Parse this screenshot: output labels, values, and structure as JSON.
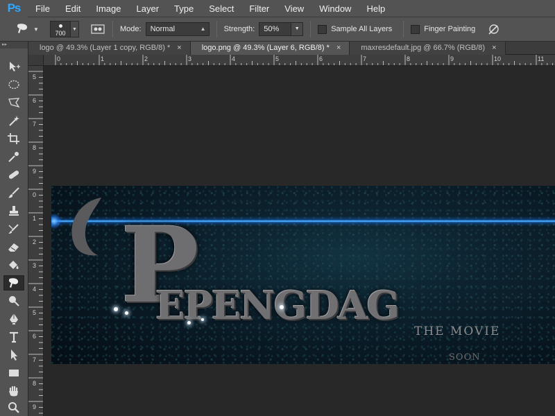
{
  "app": {
    "logo": "Ps",
    "menu": [
      "File",
      "Edit",
      "Image",
      "Layer",
      "Type",
      "Select",
      "Filter",
      "View",
      "Window",
      "Help"
    ]
  },
  "options": {
    "brush_size": "700",
    "mode_label": "Mode:",
    "mode_value": "Normal",
    "strength_label": "Strength:",
    "strength_value": "50%",
    "sample_all_layers": "Sample All Layers",
    "finger_painting": "Finger Painting"
  },
  "tabs": [
    {
      "label": "logo @ 49.3% (Layer 1 copy, RGB/8) *",
      "close": "×",
      "active": false
    },
    {
      "label": "logo.png @ 49.3% (Layer 6, RGB/8) *",
      "close": "×",
      "active": true
    },
    {
      "label": "maxresdefault.jpg @ 66.7% (RGB/8)",
      "close": "×",
      "active": false
    }
  ],
  "rulers": {
    "horizontal": [
      "0",
      "1",
      "2",
      "3",
      "4",
      "5",
      "6",
      "7",
      "8",
      "9",
      "10",
      "11",
      "12"
    ],
    "vertical": [
      "5",
      "6",
      "7",
      "8",
      "9",
      "0",
      "1",
      "2",
      "3",
      "4",
      "5",
      "6",
      "7",
      "8",
      "9"
    ]
  },
  "tools": [
    "move-tool",
    "marquee-tool",
    "lasso-tool",
    "magic-wand-tool",
    "crop-tool",
    "eyedropper-tool",
    "healing-brush-tool",
    "brush-tool",
    "clone-stamp-tool",
    "history-brush-tool",
    "eraser-tool",
    "paint-bucket-tool",
    "smudge-tool",
    "dodge-tool",
    "pen-tool",
    "type-tool",
    "path-selection-tool",
    "rectangle-tool",
    "hand-tool",
    "zoom-tool"
  ],
  "artwork": {
    "big_letter": "P",
    "title": "EPENGDAG",
    "subtitle": "THE MOVIE",
    "tagline": "SOON"
  }
}
